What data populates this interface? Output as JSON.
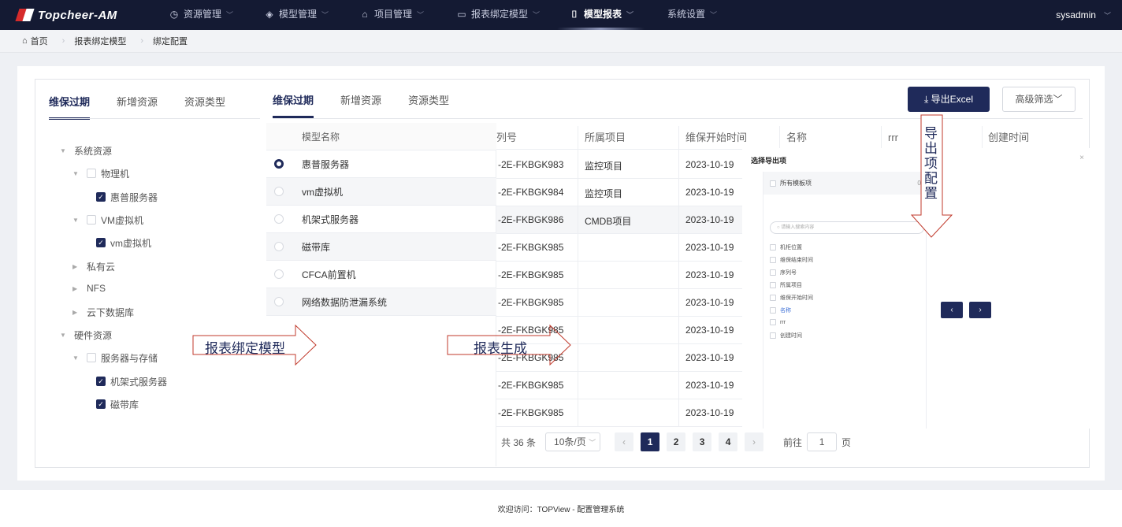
{
  "nav": {
    "logo_text": "Topcheer-AM",
    "items": [
      {
        "label": "资源管理",
        "icon": "clock-icon"
      },
      {
        "label": "模型管理",
        "icon": "layers-icon"
      },
      {
        "label": "项目管理",
        "icon": "box-icon"
      },
      {
        "label": "报表绑定模型",
        "icon": "table-icon"
      },
      {
        "label": "模型报表",
        "icon": "monitor-icon"
      },
      {
        "label": "系统设置",
        "icon": ""
      }
    ],
    "active_index": 4,
    "user": "sysadmin"
  },
  "breadcrumb": [
    "首页",
    "报表绑定模型",
    "绑定配置"
  ],
  "tabs_left": [
    "维保过期",
    "新增资源",
    "资源类型"
  ],
  "tabs_mid": [
    "维保过期",
    "新增资源",
    "资源类型"
  ],
  "tree": [
    {
      "label": "系统资源",
      "level": 0,
      "toggle": "open",
      "check": "none"
    },
    {
      "label": "物理机",
      "level": 1,
      "toggle": "open",
      "check": "off"
    },
    {
      "label": "惠普服务器",
      "level": 2,
      "toggle": "none",
      "check": "on"
    },
    {
      "label": "VM虚拟机",
      "level": 1,
      "toggle": "open",
      "check": "off"
    },
    {
      "label": "vm虚拟机",
      "level": 2,
      "toggle": "none",
      "check": "on"
    },
    {
      "label": "私有云",
      "level": 1,
      "toggle": "closed",
      "check": "none"
    },
    {
      "label": "NFS",
      "level": 1,
      "toggle": "closed",
      "check": "none"
    },
    {
      "label": "云下数据库",
      "level": 1,
      "toggle": "closed",
      "check": "none"
    },
    {
      "label": "硬件资源",
      "level": 0,
      "toggle": "open",
      "check": "none"
    },
    {
      "label": "服务器与存储",
      "level": 1,
      "toggle": "open",
      "check": "off"
    },
    {
      "label": "机架式服务器",
      "level": 2,
      "toggle": "none",
      "check": "on"
    },
    {
      "label": "磁带库",
      "level": 2,
      "toggle": "none",
      "check": "on"
    }
  ],
  "model_table": {
    "header": "模型名称",
    "rows": [
      "惠普服务器",
      "vm虚拟机",
      "机架式服务器",
      "磁带库",
      "CFCA前置机",
      "网络数据防泄漏系统"
    ],
    "selected": 0
  },
  "data_table": {
    "columns": [
      "列号",
      "所属项目",
      "维保开始时间",
      "名称",
      "rrr",
      "创建时间"
    ],
    "rows": [
      [
        "-2E-FKBGK983",
        "监控项目",
        "2023-10-19"
      ],
      [
        "-2E-FKBGK984",
        "监控项目",
        "2023-10-19"
      ],
      [
        "-2E-FKBGK986",
        "CMDB项目",
        "2023-10-19"
      ],
      [
        "-2E-FKBGK985",
        "",
        "2023-10-19"
      ],
      [
        "-2E-FKBGK985",
        "",
        "2023-10-19"
      ],
      [
        "-2E-FKBGK985",
        "",
        "2023-10-19"
      ],
      [
        "-2E-FKBGK985",
        "",
        "2023-10-19"
      ],
      [
        "-2E-FKBGK985",
        "",
        "2023-10-19"
      ],
      [
        "-2E-FKBGK985",
        "",
        "2023-10-19"
      ],
      [
        "-2E-FKBGK985",
        "",
        "2023-10-19"
      ]
    ]
  },
  "toolbar": {
    "export_label": "导出Excel",
    "filter_label": "高级筛选"
  },
  "pager": {
    "total": "共 36 条",
    "size": "10条/页",
    "pages": [
      "1",
      "2",
      "3",
      "4"
    ],
    "current": 0,
    "goto_label": "前往",
    "goto_value": "1",
    "page_suffix": "页"
  },
  "dialog": {
    "title": "选择导出项",
    "all_label": "所有模板项",
    "count_label": "0/",
    "search_placeholder": "请输入搜索内容",
    "items": [
      "机柜位置",
      "维保结束时间",
      "序列号",
      "所属项目",
      "维保开始时间",
      "名称",
      "rrr",
      "创建时间"
    ],
    "highlight": 5
  },
  "arrows": {
    "bind_label": "报表绑定模型",
    "gen_label": "报表生成",
    "export_cfg_label": "导出项配置"
  },
  "footer": "欢迎访问：TOPView - 配置管理系统"
}
